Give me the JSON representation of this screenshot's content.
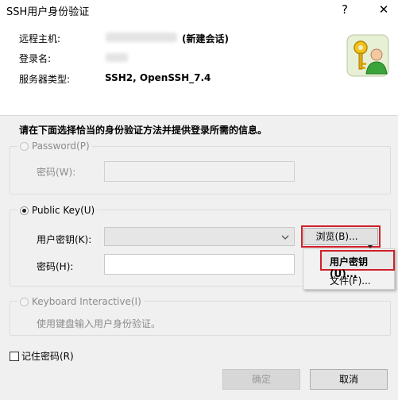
{
  "window": {
    "title": "SSH用户身份验证",
    "help_glyph": "?",
    "close_glyph": "✕"
  },
  "info": {
    "remote_host_label": "远程主机:",
    "remote_host_note": "(新建会话)",
    "login_name_label": "登录名:",
    "server_type_label": "服务器类型:",
    "server_type_value": "SSH2, OpenSSH_7.4"
  },
  "instruction": "请在下面选择恰当的身份验证方法并提供登录所需的信息。",
  "password_group": {
    "label": "Password(P)",
    "password_label": "密码(W):",
    "password_value": ""
  },
  "pubkey_group": {
    "label": "Public Key(U)",
    "user_key_label": "用户密钥(K):",
    "user_key_value": "",
    "browse_label": "浏览(B)...",
    "passphrase_label": "密码(H):",
    "passphrase_value": ""
  },
  "browse_menu": {
    "items": [
      "用户密钥(U)...",
      "文件(F)..."
    ]
  },
  "keyboard_group": {
    "label": "Keyboard Interactive(I)",
    "description": "使用键盘输入用户身份验证。"
  },
  "remember_password": {
    "label": "记住密码(R)",
    "checked": false
  },
  "buttons": {
    "ok": "确定",
    "cancel": "取消"
  },
  "colors": {
    "highlight_border": "#d0202a",
    "icon_bg": "#dfe9c8"
  },
  "icons": {
    "dialog": "keys-user-icon",
    "combo_arrow": "chevron-down-icon",
    "split_arrow": "triangle-down-icon"
  }
}
